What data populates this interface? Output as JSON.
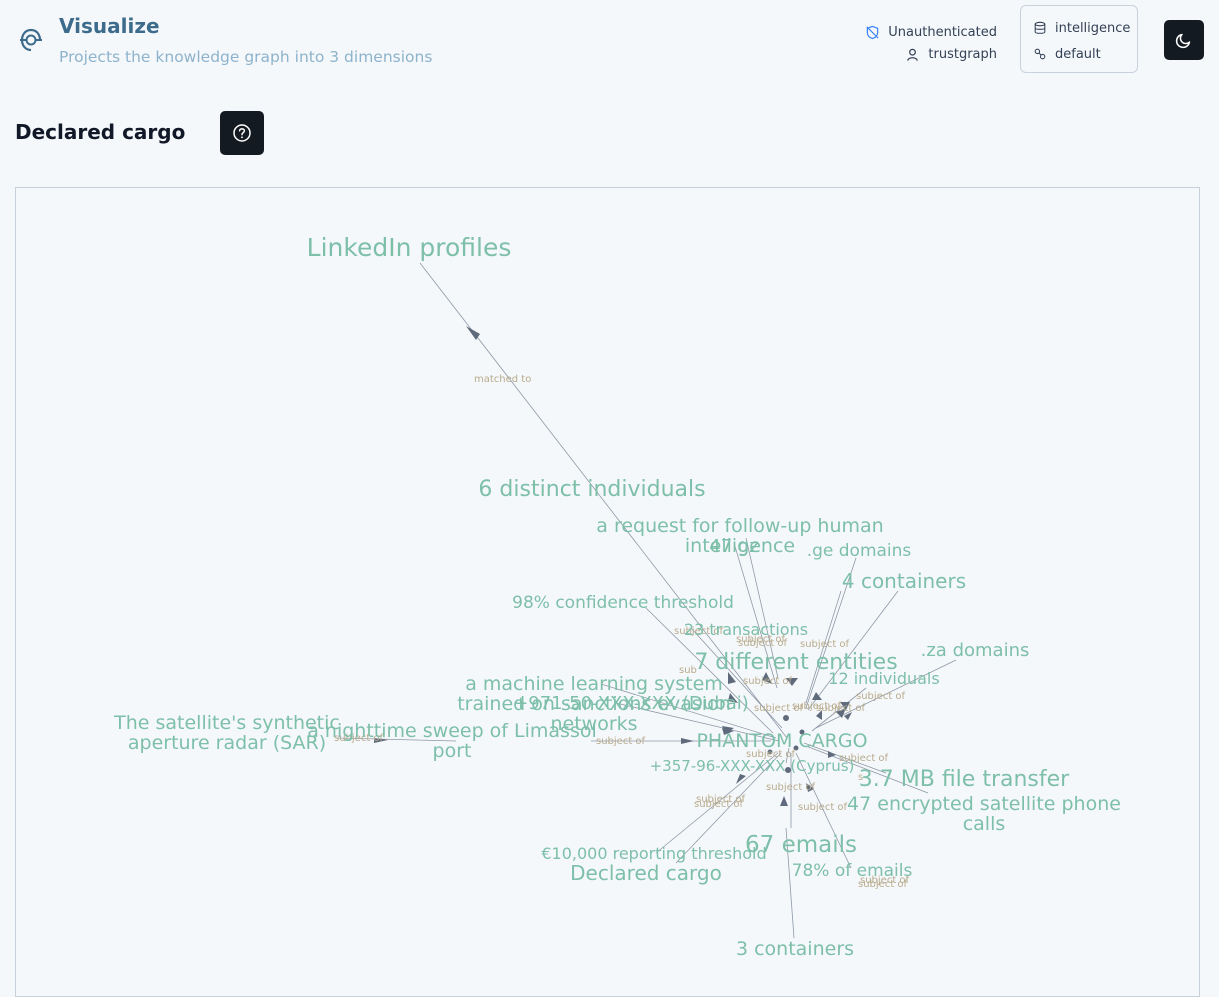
{
  "header": {
    "title": "Visualize",
    "subtitle": "Projects the knowledge graph into 3 dimensions",
    "auth_status": "Unauthenticated",
    "user": "trustgraph",
    "workspace": "intelligence",
    "collection": "default",
    "theme_icon": "moon-icon"
  },
  "section": {
    "title": "Declared cargo",
    "help_icon": "help-circle-icon"
  },
  "graph": {
    "nodes": [
      {
        "id": "n1",
        "label": "LinkedIn profiles",
        "size": 25
      },
      {
        "id": "n2",
        "label": "6 distinct individuals",
        "size": 22
      },
      {
        "id": "n3",
        "label": "a request for follow-up human",
        "size": 19
      },
      {
        "id": "n3b",
        "label": "intelligence",
        "size": 19
      },
      {
        "id": "n4",
        "label": "47 gz",
        "size": 18
      },
      {
        "id": "n5",
        "label": ".ge domains",
        "size": 17
      },
      {
        "id": "n6",
        "label": "4 containers",
        "size": 20
      },
      {
        "id": "n7",
        "label": "98% confidence threshold",
        "size": 17
      },
      {
        "id": "n8",
        "label": "23 transactions",
        "size": 16
      },
      {
        "id": "n9",
        "label": "7 different entities",
        "size": 22
      },
      {
        "id": "n10",
        "label": ".za domains",
        "size": 18
      },
      {
        "id": "n11",
        "label": "12 individuals",
        "size": 16
      },
      {
        "id": "n12",
        "label": "a machine learning system",
        "size": 19
      },
      {
        "id": "n12b",
        "label": "trained on sanctions evasion",
        "size": 19
      },
      {
        "id": "n12c",
        "label": "networks",
        "size": 19
      },
      {
        "id": "n13",
        "label": "+971-50-XXX-XXX (Dubai)",
        "size": 18
      },
      {
        "id": "n14",
        "label": "The satellite's synthetic",
        "size": 19
      },
      {
        "id": "n14b",
        "label": "aperture radar (SAR)",
        "size": 19
      },
      {
        "id": "n15",
        "label": "a nighttime sweep of Limassol",
        "size": 19
      },
      {
        "id": "n15b",
        "label": "port",
        "size": 19
      },
      {
        "id": "n16",
        "label": "PHANTOM CARGO",
        "size": 19
      },
      {
        "id": "n17",
        "label": "+357-96-XXX-XXX (Cyprus)",
        "size": 15
      },
      {
        "id": "n18",
        "label": "3.7 MB file transfer",
        "size": 22
      },
      {
        "id": "n19",
        "label": "47 encrypted satellite phone",
        "size": 19
      },
      {
        "id": "n19b",
        "label": "calls",
        "size": 19
      },
      {
        "id": "n20",
        "label": "67 emails",
        "size": 23
      },
      {
        "id": "n21",
        "label": "€10,000 reporting threshold",
        "size": 16
      },
      {
        "id": "n22",
        "label": "Declared cargo",
        "size": 20
      },
      {
        "id": "n23",
        "label": "78% of emails",
        "size": 17
      },
      {
        "id": "n24",
        "label": "3 containers",
        "size": 19
      }
    ],
    "edge_labels": [
      {
        "id": "e1",
        "label": "matched to"
      },
      {
        "id": "e2",
        "label": "subject of"
      },
      {
        "id": "e3",
        "label": "subject of"
      },
      {
        "id": "e4",
        "label": "subject of"
      },
      {
        "id": "e5",
        "label": "subject of"
      },
      {
        "id": "e6",
        "label": "sub"
      },
      {
        "id": "e7",
        "label": "subject of"
      },
      {
        "id": "e8",
        "label": "subject of"
      },
      {
        "id": "e9",
        "label": "subject of"
      },
      {
        "id": "e10",
        "label": "subject of"
      },
      {
        "id": "e11",
        "label": "subject of"
      },
      {
        "id": "e12",
        "label": "subject of"
      },
      {
        "id": "e13",
        "label": "subject of"
      },
      {
        "id": "e14",
        "label": "subject of"
      },
      {
        "id": "e15",
        "label": "subject of"
      },
      {
        "id": "e16",
        "label": "subject of"
      },
      {
        "id": "e17",
        "label": "subject of"
      },
      {
        "id": "e18",
        "label": "subject of"
      },
      {
        "id": "e19",
        "label": "subject of"
      },
      {
        "id": "e20",
        "label": "subject of"
      },
      {
        "id": "e21",
        "label": "subject of"
      },
      {
        "id": "e22",
        "label": "s"
      }
    ]
  }
}
